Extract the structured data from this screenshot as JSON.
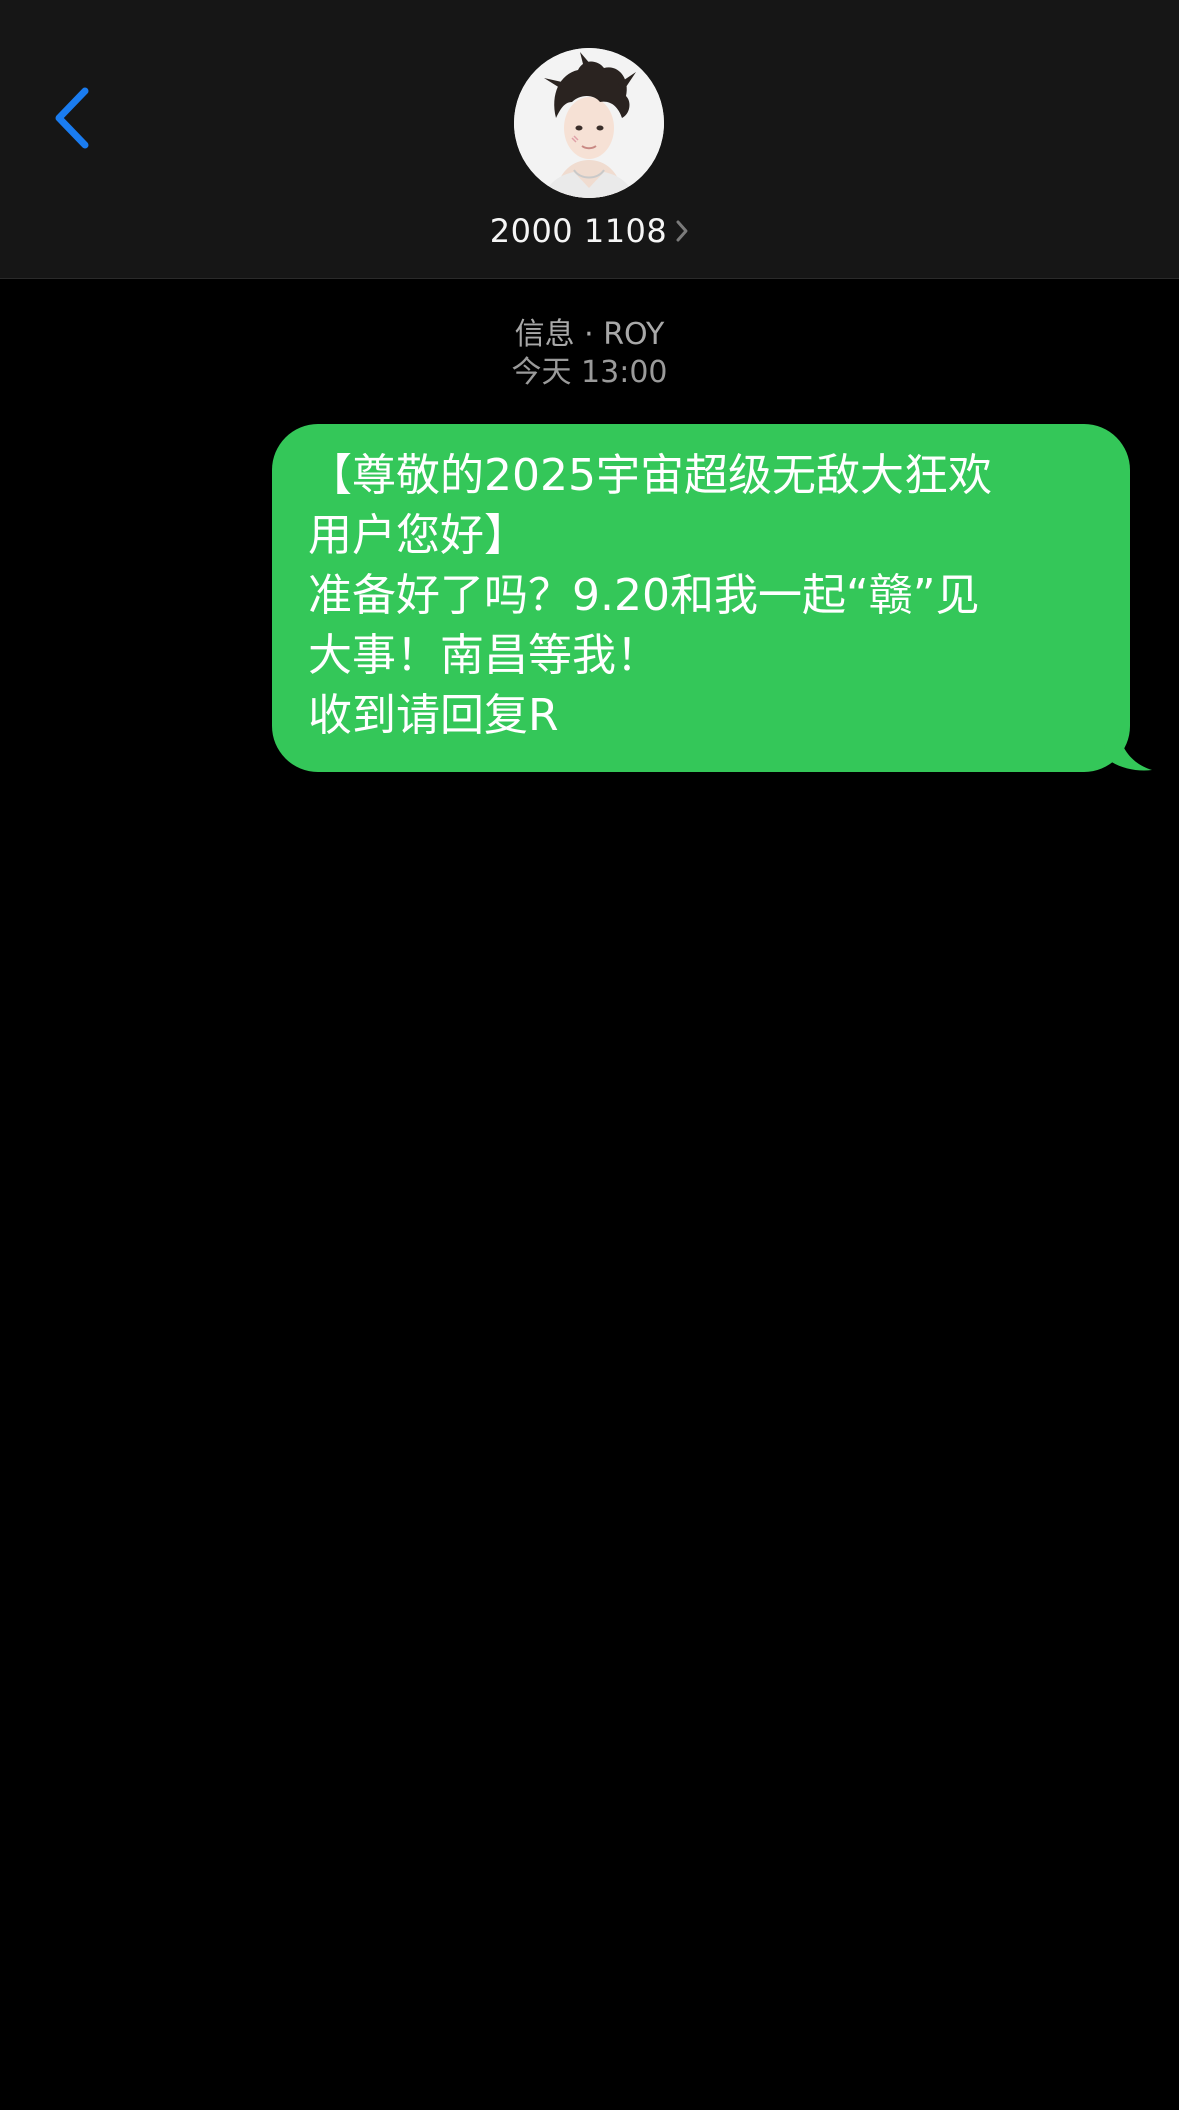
{
  "header": {
    "back_icon": "chevron-left-icon",
    "avatar_icon": "contact-avatar",
    "contact_name": "2000 1108",
    "contact_chevron": "›",
    "accent_color": "#1a7cf0"
  },
  "thread": {
    "service": "信息 · ROY",
    "timestamp": "今天 13:00"
  },
  "messages": [
    {
      "direction": "outgoing",
      "bubble_color": "#34c759",
      "lines": [
        "【尊敬的2025宇宙超级无敌大狂欢",
        "用户您好】",
        "准备好了吗？9.20和我一起“赣”见",
        "大事！南昌等我！",
        "收到请回复R"
      ]
    }
  ]
}
